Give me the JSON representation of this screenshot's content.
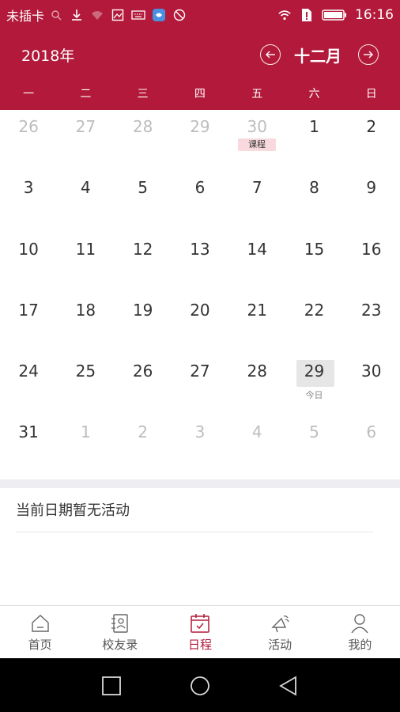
{
  "status_bar": {
    "carrier": "未插卡",
    "time": "16:16"
  },
  "header": {
    "year": "2018年",
    "month": "十二月"
  },
  "weekdays": [
    "一",
    "二",
    "三",
    "四",
    "五",
    "六",
    "日"
  ],
  "calendar": {
    "weeks": [
      [
        {
          "day": "26",
          "other": true
        },
        {
          "day": "27",
          "other": true
        },
        {
          "day": "28",
          "other": true
        },
        {
          "day": "29",
          "other": true
        },
        {
          "day": "30",
          "other": true,
          "event": "课程"
        },
        {
          "day": "1"
        },
        {
          "day": "2"
        }
      ],
      [
        {
          "day": "3"
        },
        {
          "day": "4"
        },
        {
          "day": "5"
        },
        {
          "day": "6"
        },
        {
          "day": "7"
        },
        {
          "day": "8"
        },
        {
          "day": "9"
        }
      ],
      [
        {
          "day": "10"
        },
        {
          "day": "11"
        },
        {
          "day": "12"
        },
        {
          "day": "13"
        },
        {
          "day": "14"
        },
        {
          "day": "15"
        },
        {
          "day": "16"
        }
      ],
      [
        {
          "day": "17"
        },
        {
          "day": "18"
        },
        {
          "day": "19"
        },
        {
          "day": "20"
        },
        {
          "day": "21"
        },
        {
          "day": "22"
        },
        {
          "day": "23"
        }
      ],
      [
        {
          "day": "24"
        },
        {
          "day": "25"
        },
        {
          "day": "26"
        },
        {
          "day": "27"
        },
        {
          "day": "28"
        },
        {
          "day": "29",
          "today": true,
          "today_label": "今日"
        },
        {
          "day": "30"
        }
      ],
      [
        {
          "day": "31"
        },
        {
          "day": "1",
          "other": true
        },
        {
          "day": "2",
          "other": true
        },
        {
          "day": "3",
          "other": true
        },
        {
          "day": "4",
          "other": true
        },
        {
          "day": "5",
          "other": true
        },
        {
          "day": "6",
          "other": true
        }
      ]
    ]
  },
  "activities": {
    "empty_message": "当前日期暂无活动"
  },
  "bottom_nav": {
    "items": [
      {
        "label": "首页",
        "icon": "home-icon",
        "active": false
      },
      {
        "label": "校友录",
        "icon": "contacts-book-icon",
        "active": false
      },
      {
        "label": "日程",
        "icon": "calendar-icon",
        "active": true
      },
      {
        "label": "活动",
        "icon": "megaphone-icon",
        "active": false
      },
      {
        "label": "我的",
        "icon": "profile-icon",
        "active": false
      }
    ]
  },
  "colors": {
    "brand": "#b3193a",
    "event_tag": "#f8d9de",
    "today_bg": "#e6e6e6"
  }
}
